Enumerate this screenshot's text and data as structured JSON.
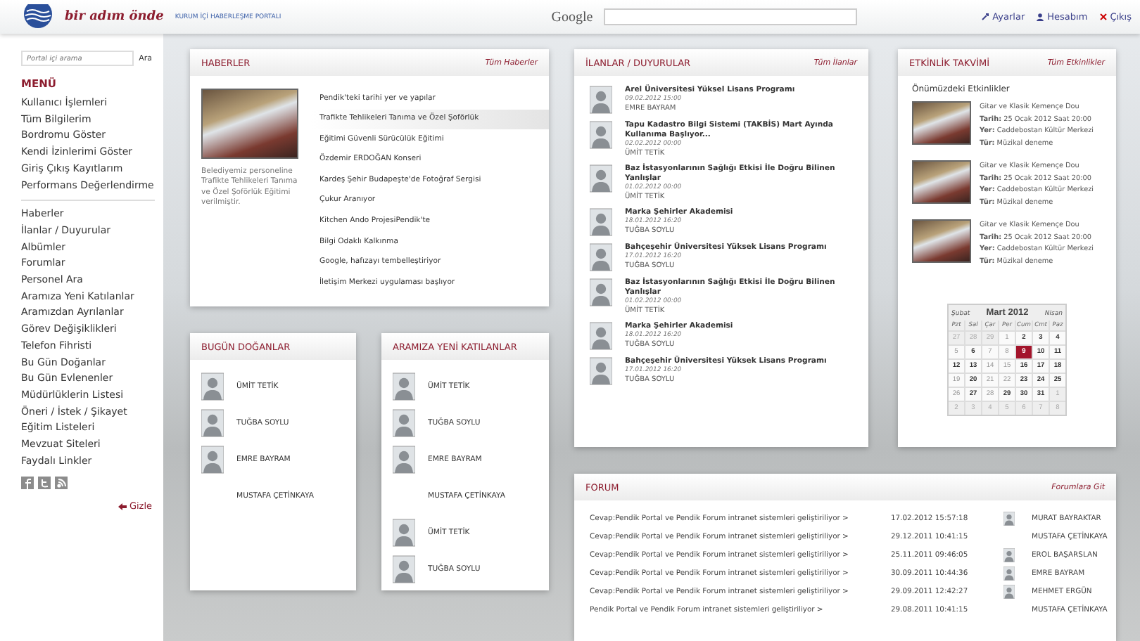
{
  "header": {
    "tagline": "bir adım önde",
    "subtitle": "KURUM İÇİ HABERLEŞME PORTALI",
    "search_label": "Google",
    "links": [
      {
        "kind": "settings",
        "label": "Ayarlar"
      },
      {
        "kind": "account",
        "label": "Hesabım"
      },
      {
        "kind": "logout",
        "label": "Çıkış"
      }
    ]
  },
  "sidebar": {
    "search": {
      "placeholder": "Portal içi arama",
      "button": "Ara"
    },
    "menu_title": "MENÜ",
    "groups": [
      [
        "Kullanıcı İşlemleri",
        "Tüm Bilgilerim",
        "Bordromu Göster",
        "Kendi İzinlerimi Göster",
        "Giriş Çıkış Kayıtlarım",
        "Performans Değerlendirme"
      ],
      [
        "Haberler",
        "İlanlar / Duyurular",
        "Albümler",
        "Forumlar",
        "Personel Ara",
        "Aramıza Yeni Katılanlar",
        "Aramızdan Ayrılanlar",
        "Görev Değişiklikleri",
        "Telefon Fihristi",
        "Bu Gün Doğanlar",
        "Bu Gün Evlenenler",
        "Müdürlüklerin Listesi",
        "Öneri / İstek / Şikayet",
        "Eğitim Listeleri",
        "Mevzuat Siteleri",
        "Faydalı Linkler"
      ]
    ],
    "social": [
      {
        "kind": "facebook"
      },
      {
        "kind": "twitter"
      },
      {
        "kind": "rss"
      }
    ],
    "hide": "Gizle"
  },
  "news": {
    "title": "HABERLER",
    "link": "Tüm Haberler",
    "caption": "Belediyemiz personeline Trafikte Tehlikeleri Tanıma ve Özel Şoförlük Eğitimi verilmiştir.",
    "items": [
      {
        "text": "Pendik'teki tarihi yer ve yapılar",
        "selected": false
      },
      {
        "text": "Trafikte Tehlikeleri Tanıma ve Özel Şoförlük",
        "selected": true
      },
      {
        "text": "Eğitimi Güvenli Sürücülük Eğitimi",
        "selected": false
      },
      {
        "text": "Özdemir ERDOĞAN Konseri",
        "selected": false
      },
      {
        "text": "Kardeş Şehir Budapeşte'de Fotoğraf Sergisi",
        "selected": false
      },
      {
        "text": "Çukur Aranıyor",
        "selected": false
      },
      {
        "text": "Kitchen Ando ProjesiPendik'te",
        "selected": false
      },
      {
        "text": "Bilgi Odaklı Kalkınma",
        "selected": false
      },
      {
        "text": "Google, hafızayı tembelleştiriyor",
        "selected": false
      },
      {
        "text": "İletişim Merkezi uygulaması başlıyor",
        "selected": false
      }
    ]
  },
  "birthdays": {
    "title": "BUGÜN DOĞANLAR",
    "people": [
      {
        "name": "ÜMİT TETİK",
        "has_photo": true
      },
      {
        "name": "TUĞBA SOYLU",
        "has_photo": true
      },
      {
        "name": "EMRE BAYRAM",
        "has_photo": true
      },
      {
        "name": "MUSTAFA ÇETİNKAYA",
        "has_photo": false
      }
    ]
  },
  "newcomers": {
    "title": "ARAMIZA YENİ KATILANLAR",
    "people": [
      {
        "name": "ÜMİT TETİK",
        "has_photo": true
      },
      {
        "name": "TUĞBA SOYLU",
        "has_photo": true
      },
      {
        "name": "EMRE BAYRAM",
        "has_photo": true
      },
      {
        "name": "MUSTAFA ÇETİNKAYA",
        "has_photo": false
      },
      {
        "name": "ÜMİT TETİK",
        "has_photo": true
      },
      {
        "name": "TUĞBA SOYLU",
        "has_photo": true
      }
    ]
  },
  "announcements": {
    "title": "İLANLAR / DUYURULAR",
    "link": "Tüm İlanlar",
    "items": [
      {
        "title": "Arel Üniversitesi Yüksel Lisans Programı",
        "date": "09.02.2012 15:00",
        "author": "EMRE BAYRAM"
      },
      {
        "title": "Tapu Kadastro Bilgi Sistemi (TAKBİS) Mart Ayında Kullanıma Başlıyor...",
        "date": "02.02.2012 00:00",
        "author": "ÜMİT TETİK"
      },
      {
        "title": "Baz İstasyonlarının Sağlığı Etkisi İle Doğru Bilinen Yanlışlar",
        "date": "01.02.2012 00:00",
        "author": "ÜMİT TETİK"
      },
      {
        "title": "Marka Şehirler Akademisi",
        "date": "18.01.2012 16:20",
        "author": "TUĞBA SOYLU"
      },
      {
        "title": "Bahçeşehir Üniversitesi Yüksek Lisans Programı",
        "date": "17.01.2012 16:20",
        "author": "TUĞBA SOYLU"
      },
      {
        "title": "Baz İstasyonlarının Sağlığı Etkisi İle Doğru Bilinen Yanlışlar",
        "date": "01.02.2012 00:00",
        "author": "ÜMİT TETİK"
      },
      {
        "title": "Marka Şehirler Akademisi",
        "date": "18.01.2012 16:20",
        "author": "TUĞBA SOYLU"
      },
      {
        "title": "Bahçeşehir Üniversitesi Yüksek Lisans Programı",
        "date": "17.01.2012 16:20",
        "author": "TUĞBA SOYLU"
      }
    ]
  },
  "events": {
    "title": "ETKİNLİK TAKVİMİ",
    "link": "Tüm Etkinlikler",
    "subtitle": "Önümüzdeki Etkinlikler",
    "items": [
      {
        "title": "Gitar ve Klasik Kemençe Dou",
        "date_label": "Tarih:",
        "date": "25 Ocak 2012 Saat 20:00",
        "place_label": "Yer:",
        "place": "Caddebostan Kültür Merkezi",
        "type_label": "Tür:",
        "type": "Müzikal deneme"
      },
      {
        "title": "Gitar ve Klasik Kemençe Dou",
        "date_label": "Tarih:",
        "date": "25 Ocak 2012 Saat 20:00",
        "place_label": "Yer:",
        "place": "Caddebostan Kültür Merkezi",
        "type_label": "Tür:",
        "type": "Müzikal deneme"
      },
      {
        "title": "Gitar ve Klasik Kemençe Dou",
        "date_label": "Tarih:",
        "date": "25 Ocak 2012 Saat 20:00",
        "place_label": "Yer:",
        "place": "Caddebostan Kültür Merkezi",
        "type_label": "Tür:",
        "type": "Müzikal deneme"
      }
    ],
    "calendar": {
      "prev": "Şubat",
      "month": "Mart 2012",
      "next": "Nisan",
      "weekdays": [
        "Pzt",
        "Sal",
        "Çar",
        "Per",
        "Cum",
        "Cmt",
        "Paz"
      ],
      "days": [
        {
          "day": "27",
          "other_month": true,
          "has_event": false,
          "selected": false
        },
        {
          "day": "28",
          "other_month": true,
          "has_event": false,
          "selected": false
        },
        {
          "day": "29",
          "other_month": true,
          "has_event": false,
          "selected": false
        },
        {
          "day": "1",
          "other_month": false,
          "has_event": false,
          "selected": false
        },
        {
          "day": "2",
          "other_month": false,
          "has_event": true,
          "selected": false
        },
        {
          "day": "3",
          "other_month": false,
          "has_event": true,
          "selected": false
        },
        {
          "day": "4",
          "other_month": false,
          "has_event": true,
          "selected": false
        },
        {
          "day": "5",
          "other_month": false,
          "has_event": false,
          "selected": false
        },
        {
          "day": "6",
          "other_month": false,
          "has_event": true,
          "selected": false
        },
        {
          "day": "7",
          "other_month": false,
          "has_event": false,
          "selected": false
        },
        {
          "day": "8",
          "other_month": false,
          "has_event": false,
          "selected": false
        },
        {
          "day": "9",
          "other_month": false,
          "has_event": true,
          "selected": true
        },
        {
          "day": "10",
          "other_month": false,
          "has_event": true,
          "selected": false
        },
        {
          "day": "11",
          "other_month": false,
          "has_event": true,
          "selected": false
        },
        {
          "day": "12",
          "other_month": false,
          "has_event": true,
          "selected": false
        },
        {
          "day": "13",
          "other_month": false,
          "has_event": true,
          "selected": false
        },
        {
          "day": "14",
          "other_month": false,
          "has_event": false,
          "selected": false
        },
        {
          "day": "15",
          "other_month": false,
          "has_event": false,
          "selected": false
        },
        {
          "day": "16",
          "other_month": false,
          "has_event": true,
          "selected": false
        },
        {
          "day": "17",
          "other_month": false,
          "has_event": true,
          "selected": false
        },
        {
          "day": "18",
          "other_month": false,
          "has_event": true,
          "selected": false
        },
        {
          "day": "19",
          "other_month": false,
          "has_event": false,
          "selected": false
        },
        {
          "day": "20",
          "other_month": false,
          "has_event": true,
          "selected": false
        },
        {
          "day": "21",
          "other_month": false,
          "has_event": false,
          "selected": false
        },
        {
          "day": "22",
          "other_month": false,
          "has_event": false,
          "selected": false
        },
        {
          "day": "23",
          "other_month": false,
          "has_event": true,
          "selected": false
        },
        {
          "day": "24",
          "other_month": false,
          "has_event": true,
          "selected": false
        },
        {
          "day": "25",
          "other_month": false,
          "has_event": true,
          "selected": false
        },
        {
          "day": "26",
          "other_month": false,
          "has_event": false,
          "selected": false
        },
        {
          "day": "27",
          "other_month": false,
          "has_event": true,
          "selected": false
        },
        {
          "day": "28",
          "other_month": false,
          "has_event": false,
          "selected": false
        },
        {
          "day": "29",
          "other_month": false,
          "has_event": true,
          "selected": false
        },
        {
          "day": "30",
          "other_month": false,
          "has_event": true,
          "selected": false
        },
        {
          "day": "31",
          "other_month": false,
          "has_event": true,
          "selected": false
        },
        {
          "day": "1",
          "other_month": true,
          "has_event": false,
          "selected": false
        },
        {
          "day": "2",
          "other_month": true,
          "has_event": false,
          "selected": false
        },
        {
          "day": "3",
          "other_month": true,
          "has_event": false,
          "selected": false
        },
        {
          "day": "4",
          "other_month": true,
          "has_event": false,
          "selected": false
        },
        {
          "day": "5",
          "other_month": true,
          "has_event": false,
          "selected": false
        },
        {
          "day": "6",
          "other_month": true,
          "has_event": false,
          "selected": false
        },
        {
          "day": "7",
          "other_month": true,
          "has_event": false,
          "selected": false
        },
        {
          "day": "8",
          "other_month": true,
          "has_event": false,
          "selected": false
        }
      ]
    }
  },
  "forum": {
    "title": "FORUM",
    "link": "Forumlara Git",
    "rows": [
      {
        "topic": "Cevap:Pendik Portal ve Pendik Forum intranet sistemleri geliştiriliyor  >",
        "date": "17.02.2012 15:57:18",
        "author": "MURAT BAYRAKTAR",
        "has_photo": true
      },
      {
        "topic": "Cevap:Pendik Portal ve Pendik Forum intranet sistemleri geliştiriliyor  >",
        "date": "29.12.2011 10:41:15",
        "author": "MUSTAFA ÇETİNKAYA",
        "has_photo": false
      },
      {
        "topic": "Cevap:Pendik Portal ve Pendik Forum intranet sistemleri geliştiriliyor  >",
        "date": "25.11.2011 09:46:05",
        "author": "EROL BAŞARSLAN",
        "has_photo": true
      },
      {
        "topic": "Cevap:Pendik Portal ve Pendik Forum intranet sistemleri geliştiriliyor  >",
        "date": "30.09.2011 10:44:36",
        "author": "EMRE BAYRAM",
        "has_photo": true
      },
      {
        "topic": "Cevap:Pendik Portal ve Pendik Forum intranet sistemleri geliştiriliyor  >",
        "date": "29.09.2011 12:42:27",
        "author": "MEHMET ERGÜN",
        "has_photo": true
      },
      {
        "topic": "Pendik Portal ve Pendik Forum intranet sistemleri geliştiriliyor  >",
        "date": "29.08.2011 10:41:15",
        "author": "MUSTAFA ÇETİNKAYA",
        "has_photo": false
      }
    ]
  }
}
